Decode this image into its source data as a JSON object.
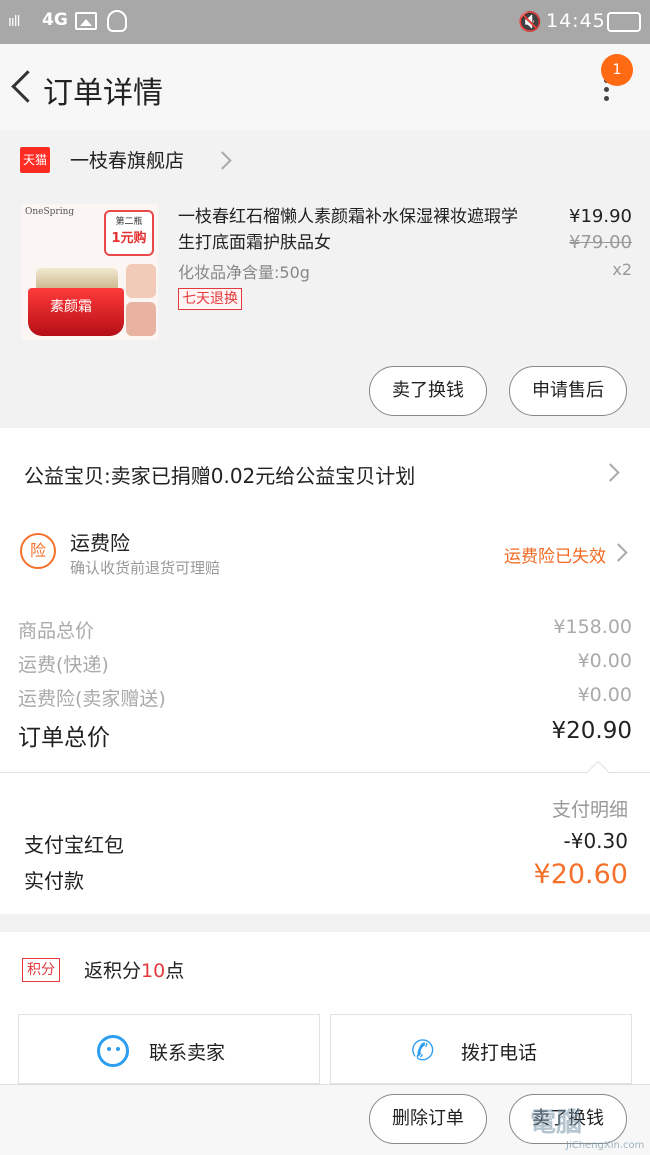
{
  "status_bar": {
    "signal": "ııll",
    "network": "4G",
    "time": "14:45",
    "mute_glyph": "🔇"
  },
  "header": {
    "title": "订单详情",
    "notification_count": "1"
  },
  "shop": {
    "platform_badge": "天猫",
    "name": "一枝春旗舰店"
  },
  "product": {
    "title": "一枝春红石榴懒人素颜霜补水保湿裸妆遮瑕学生打底面霜护肤品女",
    "spec": "化妆品净含量:50g",
    "tag": "七天退换",
    "price": "¥19.90",
    "original_price": "¥79.00",
    "quantity": "x2",
    "image": {
      "brand": "OneSpring",
      "promo_line1": "第二瓶",
      "promo_line2": "1元购",
      "jar_label": "素颜霜"
    },
    "buttons": {
      "refund": "卖了换钱",
      "after_sale": "申请售后"
    }
  },
  "charity": {
    "text": "公益宝贝:卖家已捐赠0.02元给公益宝贝计划"
  },
  "insurance": {
    "icon_text": "险",
    "name": "运费险",
    "desc": "确认收货前退货可理赔",
    "status": "运费险已失效"
  },
  "costs": {
    "rows": [
      {
        "label": "商品总价",
        "value": "¥158.00"
      },
      {
        "label": "运费(快递)",
        "value": "¥0.00"
      },
      {
        "label": "运费险(卖家赠送)",
        "value": "¥0.00"
      }
    ],
    "total_label": "订单总价",
    "total_value": "¥20.90"
  },
  "payment": {
    "detail_label": "支付明细",
    "red_packet_label": "支付宝红包",
    "red_packet_value": "-¥0.30",
    "actual_label": "实付款",
    "actual_value": "¥20.60"
  },
  "points": {
    "tag": "积分",
    "prefix": "返积分",
    "count": "10",
    "suffix": "点"
  },
  "contact": {
    "seller_label": "联系卖家",
    "call_label": "拨打电话"
  },
  "bottom": {
    "delete_label": "删除订单",
    "sell_label": "卖了换钱"
  },
  "watermark": {
    "main": "電腦",
    "sub": "JiChengXin.com"
  },
  "colors": {
    "accent": "#f5712b",
    "tmall_red": "#ff2c24",
    "link_blue": "#2d9ef0"
  }
}
